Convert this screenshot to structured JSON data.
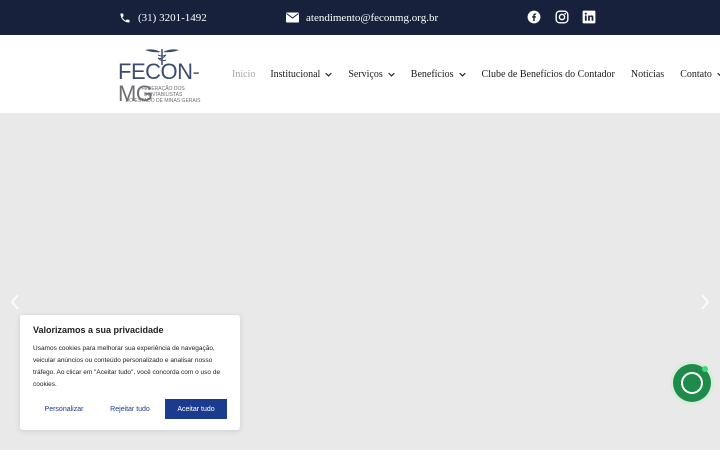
{
  "topbar": {
    "phone": "(31) 3201-1492",
    "email": "atendimento@feconmg.org.br",
    "social": [
      "facebook-icon",
      "instagram-icon",
      "linkedin-icon"
    ]
  },
  "logo": {
    "word_main": "FECON",
    "word_suffix": "-MG",
    "subtitle_1": "FEDERAÇÃO DOS CONTABILISTAS",
    "subtitle_2": "DO ESTADO DE MINAS GERAIS"
  },
  "nav": {
    "items": [
      {
        "label": "Início",
        "active": true,
        "dropdown": false
      },
      {
        "label": "Institucional",
        "active": false,
        "dropdown": true
      },
      {
        "label": "Serviços",
        "active": false,
        "dropdown": true
      },
      {
        "label": "Benefícios",
        "active": false,
        "dropdown": true
      },
      {
        "label": "Clube de Benefícios do Contador",
        "active": false,
        "dropdown": false
      },
      {
        "label": "Notícias",
        "active": false,
        "dropdown": false
      },
      {
        "label": "Contato",
        "active": false,
        "dropdown": true
      }
    ]
  },
  "cookie": {
    "title": "Valorizamos a sua privacidade",
    "text": "Usamos cookies para melhorar sua experiência de navegação, veicular anúncios ou conteúdo personalizado e analisar nosso tráfego. Ao clicar em \"Aceitar tudo\", você concorda com o uso de cookies.",
    "btn_personalize": "Personalizar",
    "btn_reject": "Rejeitar tudo",
    "btn_accept": "Aceitar tudo"
  },
  "colors": {
    "topbar_bg": "#17213c",
    "accent_blue": "#1a3b8e",
    "chat_green": "#1e8b4b",
    "hero_bg": "#e8e9e8"
  }
}
